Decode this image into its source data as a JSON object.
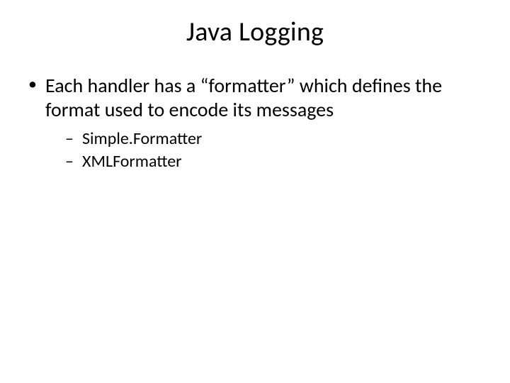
{
  "slide": {
    "title": "Java Logging",
    "bullets": [
      {
        "text": "Each handler has a “formatter” which defines the format used to encode its messages",
        "sub": [
          "Simple.Formatter",
          "XMLFormatter"
        ]
      }
    ]
  }
}
